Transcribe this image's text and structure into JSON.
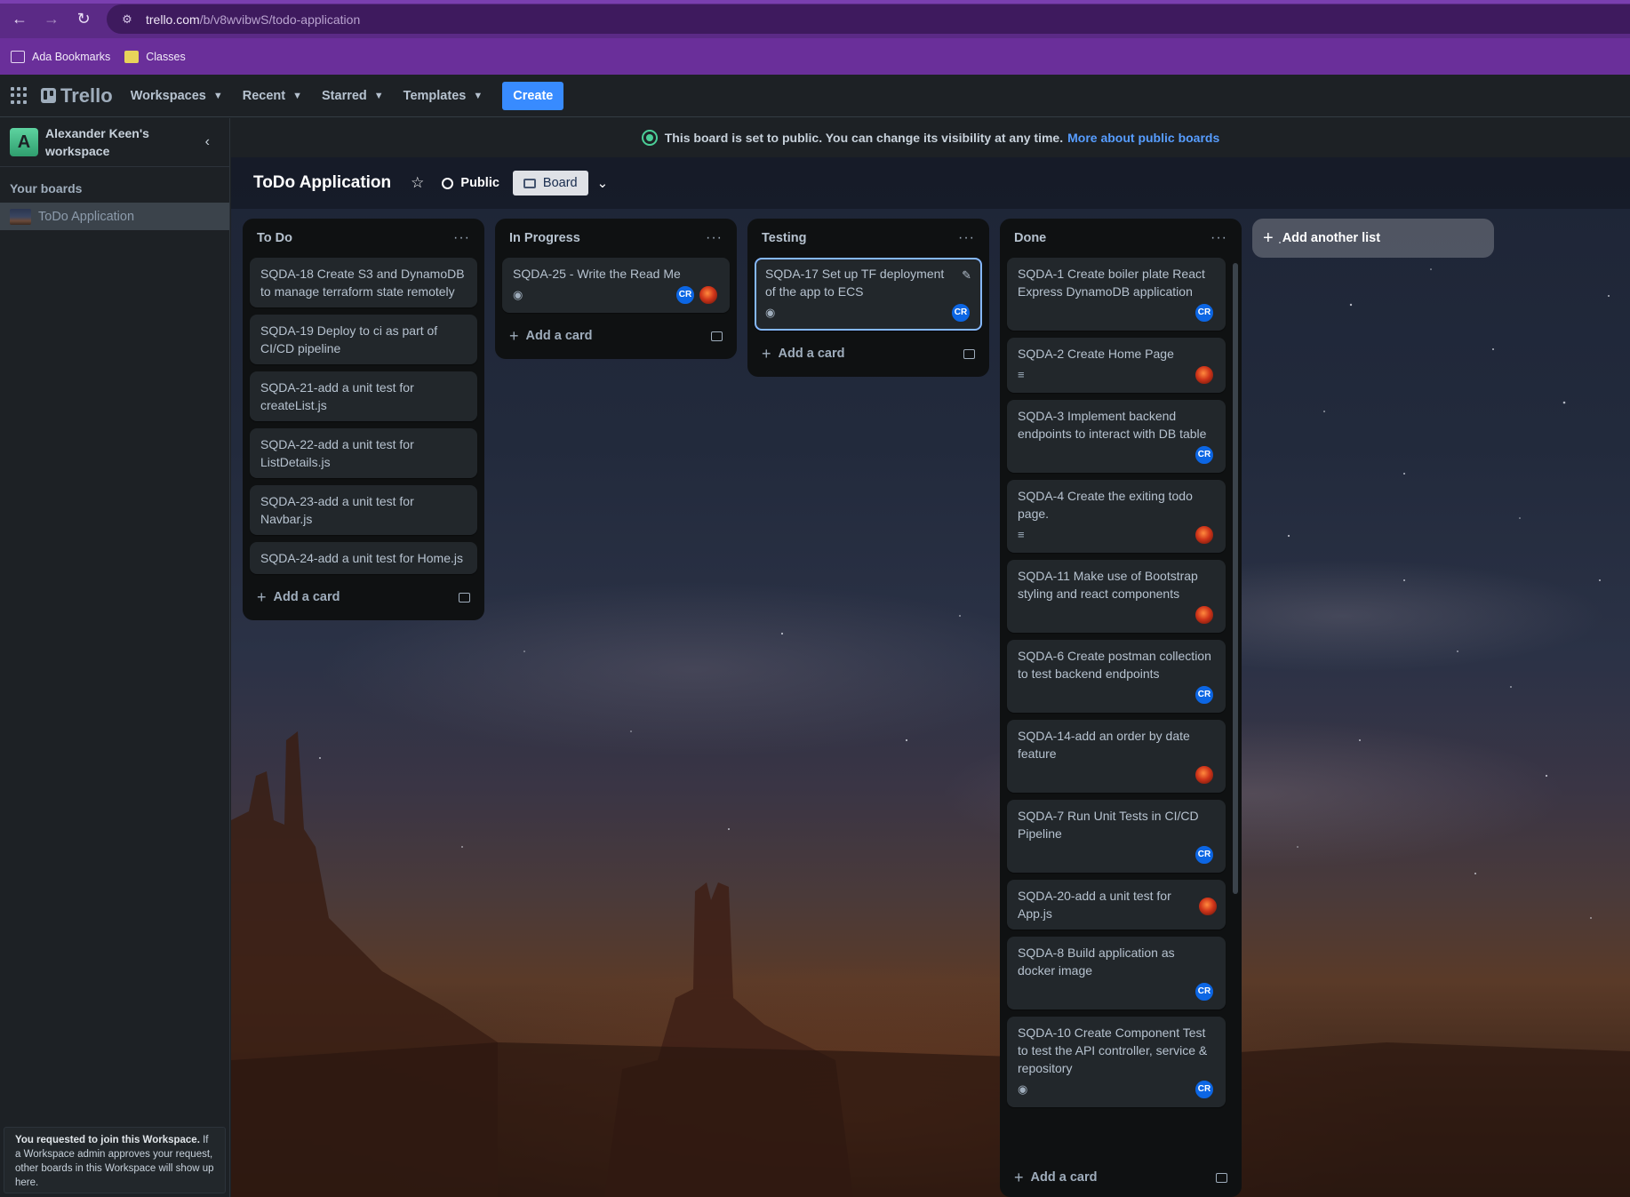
{
  "browser": {
    "url_host": "trello.com",
    "url_path": "/b/v8wvibwS/todo-application",
    "bookmarks": [
      {
        "label": "Ada Bookmarks",
        "icon": "folder-icon"
      },
      {
        "label": "Classes",
        "icon": "classroom-icon"
      }
    ]
  },
  "header": {
    "logo": "Trello",
    "menus": [
      "Workspaces",
      "Recent",
      "Starred",
      "Templates"
    ],
    "create_label": "Create"
  },
  "sidebar": {
    "workspace_initial": "A",
    "workspace_name": "Alexander Keen's workspace",
    "your_boards_label": "Your boards",
    "boards": [
      "ToDo Application"
    ],
    "join_notice_bold": "You requested to join this Workspace.",
    "join_notice_text": " If a Workspace admin approves your request, other boards in this Workspace will show up here."
  },
  "banner": {
    "text": "This board is set to public. You can change its visibility at any time.",
    "link": "More about public boards"
  },
  "board": {
    "title": "ToDo Application",
    "visibility": "Public",
    "view": "Board",
    "add_list_label": "Add another list",
    "add_card_label": "Add a card",
    "lists": [
      {
        "title": "To Do",
        "cards": [
          {
            "text": "SQDA-18 Create S3 and DynamoDB to manage terraform state remotely"
          },
          {
            "text": "SQDA-19 Deploy to ci as part of CI/CD pipeline"
          },
          {
            "text": "SQDA-21-add a unit test for createList.js"
          },
          {
            "text": "SQDA-22-add a unit test for ListDetails.js"
          },
          {
            "text": "SQDA-23-add a unit test for Navbar.js"
          },
          {
            "text": "SQDA-24-add a unit test for Home.js"
          }
        ]
      },
      {
        "title": "In Progress",
        "cards": [
          {
            "text": "SQDA-25 - Write the Read Me",
            "watch": true,
            "members": [
              "CR",
              "fire"
            ]
          }
        ]
      },
      {
        "title": "Testing",
        "cards": [
          {
            "text": "SQDA-17 Set up TF deployment of the app to ECS",
            "watch": true,
            "members": [
              "CR"
            ],
            "focused": true
          }
        ]
      },
      {
        "title": "Done",
        "cards": [
          {
            "text": "SQDA-1 Create boiler plate React Express DynamoDB application",
            "members": [
              "CR"
            ]
          },
          {
            "text": "SQDA-2 Create Home Page",
            "description": true,
            "members": [
              "fire"
            ]
          },
          {
            "text": "SQDA-3 Implement backend endpoints to interact with DB table",
            "members": [
              "CR"
            ]
          },
          {
            "text": "SQDA-4 Create the exiting todo page.",
            "description": true,
            "members": [
              "fire"
            ]
          },
          {
            "text": "SQDA-11 Make use of Bootstrap styling and react components",
            "members": [
              "fire"
            ]
          },
          {
            "text": "SQDA-6 Create postman collection to test backend endpoints",
            "members": [
              "CR"
            ]
          },
          {
            "text": "SQDA-14-add an order by date feature",
            "members": [
              "fire"
            ]
          },
          {
            "text": "SQDA-7 Run Unit Tests in CI/CD Pipeline",
            "members": [
              "CR"
            ]
          },
          {
            "text": "SQDA-20-add a unit test for App.js",
            "members": [
              "fire"
            ],
            "inline_member": true
          },
          {
            "text": "SQDA-8 Build application as docker image",
            "members": [
              "CR"
            ]
          },
          {
            "text": "SQDA-10 Create Component Test to test the API controller, service & repository",
            "watch": true,
            "members": [
              "CR"
            ]
          }
        ]
      }
    ]
  },
  "colors": {
    "browser_frame": "#5b2a86",
    "create_button": "#388bff",
    "member_cr": "#0c66e4",
    "link": "#579dff"
  }
}
